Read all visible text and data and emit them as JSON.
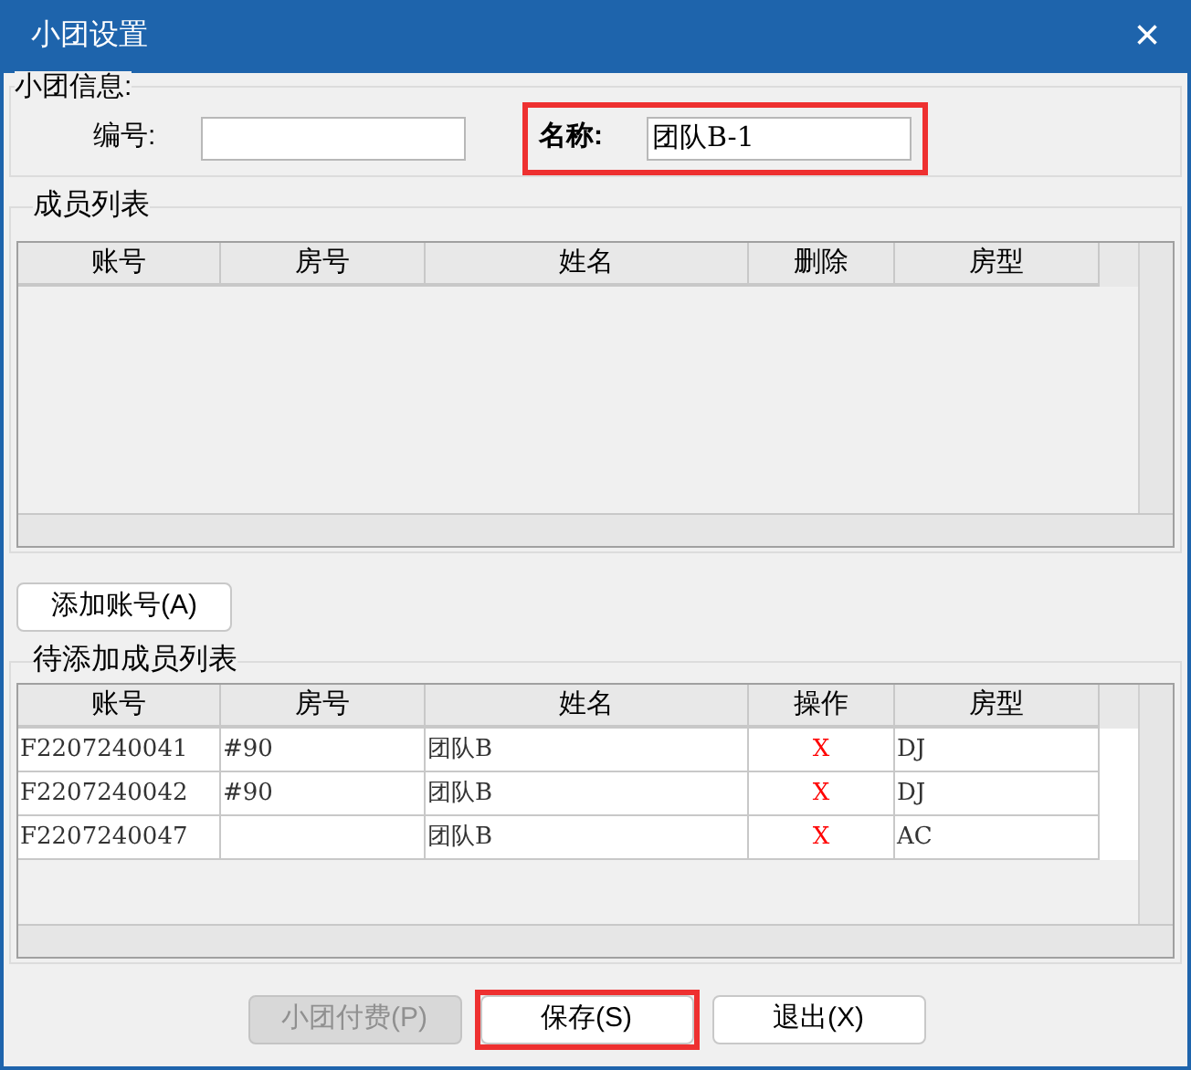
{
  "window": {
    "title": "小团设置",
    "close": "×"
  },
  "info": {
    "title": "小团信息:",
    "fields": [
      {
        "label": "编号:",
        "highlighted": false,
        "bold": false
      },
      {
        "label": "名称:",
        "value": "团队B-1",
        "highlighted": true,
        "bold": true
      }
    ]
  },
  "members": {
    "title": "成员列表",
    "columns": [
      "账号",
      "房号",
      "姓名",
      "删除",
      "房型"
    ]
  },
  "add_button": {
    "label": "添加账号(A)"
  },
  "pending": {
    "title": "待添加成员列表",
    "columns": [
      "账号",
      "房号",
      "姓名",
      "操作",
      "房型"
    ],
    "rows": [
      [
        "F2207240041",
        "#90",
        "团队B",
        "X",
        "DJ"
      ],
      [
        "F2207240042",
        "#90",
        "团队B",
        "X",
        "DJ"
      ],
      [
        "F2207240047",
        "",
        "团队B",
        "X",
        "AC"
      ]
    ]
  },
  "buttons": [
    {
      "label": "小团付费(P)",
      "disabled": true,
      "highlighted": false
    },
    {
      "label": "保存(S)",
      "disabled": false,
      "highlighted": true
    },
    {
      "label": "退出(X)",
      "disabled": false,
      "highlighted": false
    }
  ]
}
